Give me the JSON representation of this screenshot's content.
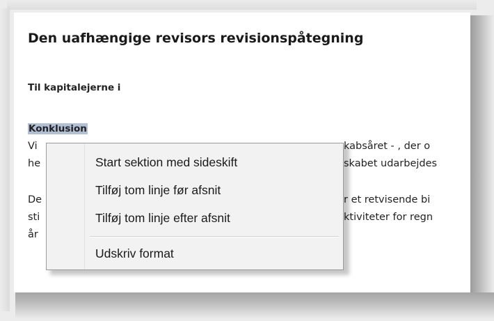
{
  "document": {
    "title": "Den uafhængige revisors revisionspåtegning",
    "subtitle": "Til kapitalejerne i",
    "heading": "Konklusion",
    "paragraph1": {
      "line1_start": "Vi",
      "line1_end": "kabsåret - , der o",
      "line2_start": "he",
      "line2_end": "skabet udarbejdes"
    },
    "paragraph2": {
      "line1_start": "De",
      "line1_end": "r et retvisende bi",
      "line2_start": "sti",
      "line2_end": "ktiviteter  for regn",
      "line3_start": "år"
    }
  },
  "context_menu": {
    "items": [
      "Start sektion med sideskift",
      "Tilføj tom linje før afsnit",
      "Tilføj tom linje efter afsnit",
      "Udskriv format"
    ]
  }
}
